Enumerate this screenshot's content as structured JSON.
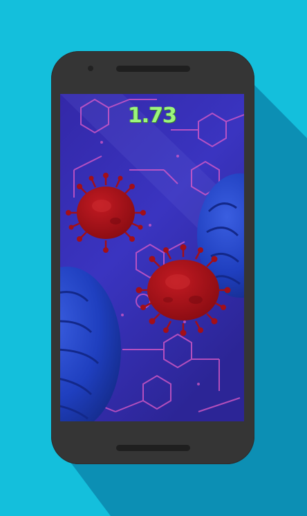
{
  "game": {
    "score": "1.73"
  },
  "colors": {
    "page_background": "#14bfdc",
    "page_shadow": "#0c8fb4",
    "phone_body": "#353535",
    "screen_background": "#3a2fb0",
    "molecule_lines": "#e05cc8",
    "cell_blue": "#1f3fbf",
    "virus_red": "#a30f18",
    "score_green": "#9cf57c"
  },
  "sprites": [
    {
      "name": "virus",
      "icon": "coronavirus-icon",
      "count": 2
    },
    {
      "name": "cell",
      "icon": "blue-cell-icon",
      "count": 2
    }
  ]
}
